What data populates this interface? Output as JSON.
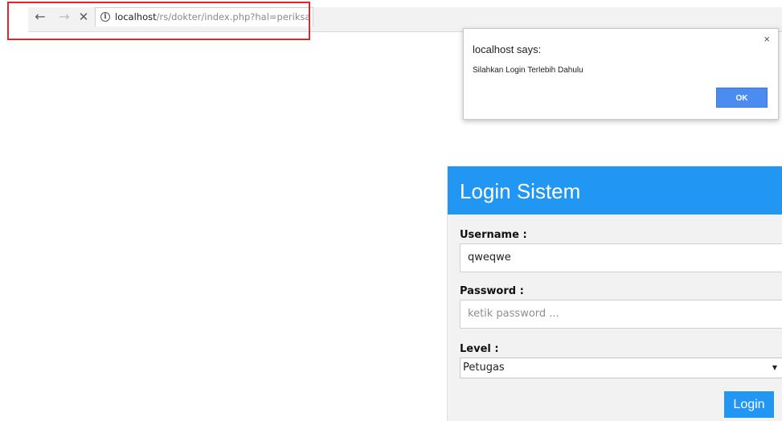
{
  "browser": {
    "nav": {
      "back_icon": "arrow-left-icon",
      "forward_icon": "arrow-right-icon",
      "stop_icon": "close-icon"
    },
    "address_bar": {
      "info_icon": "info-icon",
      "url_host": "localhost",
      "url_path": "/rs/dokter/index.php?hal=periksa"
    },
    "highlight_color": "#e0262e"
  },
  "alert": {
    "title": "localhost says:",
    "close_label": "×",
    "message": "Silahkan Login Terlebih Dahulu",
    "ok_label": "OK",
    "ok_color": "#4a8cf0"
  },
  "login": {
    "title": "Login Sistem",
    "header_color": "#2196f3",
    "username": {
      "label": "Username :",
      "value": "qweqwe"
    },
    "password": {
      "label": "Password :",
      "placeholder": "ketik password ..."
    },
    "level": {
      "label": "Level :",
      "selected": "Petugas"
    },
    "submit_label": "Login"
  }
}
